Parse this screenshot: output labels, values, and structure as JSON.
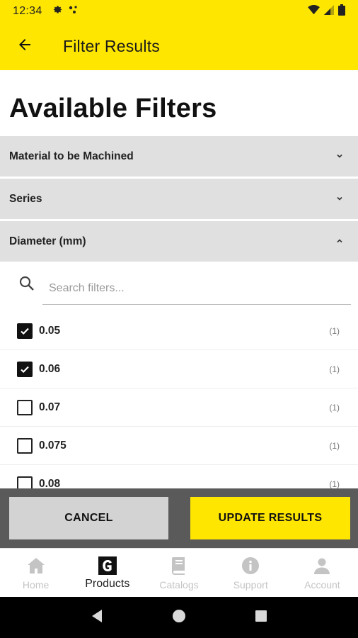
{
  "status_bar": {
    "time": "12:34",
    "left_icons": [
      "gear-icon",
      "notification-dots-icon"
    ],
    "right_icons": [
      "wifi-icon",
      "signal-icon",
      "battery-icon"
    ]
  },
  "app_bar": {
    "back_icon": "arrow-left-icon",
    "title": "Filter Results"
  },
  "page": {
    "heading": "Available Filters"
  },
  "sections": [
    {
      "label": "Material to be Machined",
      "expanded": false
    },
    {
      "label": "Series",
      "expanded": false
    },
    {
      "label": "Diameter (mm)",
      "expanded": true
    }
  ],
  "search": {
    "placeholder": "Search filters..."
  },
  "options": [
    {
      "label": "0.05",
      "count": "(1)",
      "checked": true
    },
    {
      "label": "0.06",
      "count": "(1)",
      "checked": true
    },
    {
      "label": "0.07",
      "count": "(1)",
      "checked": false
    },
    {
      "label": "0.075",
      "count": "(1)",
      "checked": false
    },
    {
      "label": "0.08",
      "count": "(1)",
      "checked": false
    }
  ],
  "actions": {
    "cancel_label": "CANCEL",
    "update_label": "UPDATE RESULTS"
  },
  "bottom_nav": [
    {
      "label": "Home",
      "icon": "home-icon",
      "active": false
    },
    {
      "label": "Products",
      "icon": "products-g-icon",
      "active": true
    },
    {
      "label": "Catalogs",
      "icon": "book-icon",
      "active": false
    },
    {
      "label": "Support",
      "icon": "info-icon",
      "active": false
    },
    {
      "label": "Account",
      "icon": "person-icon",
      "active": false
    }
  ],
  "colors": {
    "brand_yellow": "#ffe600",
    "section_gray": "#e0e0e0",
    "action_bar": "#5a5a5a",
    "cancel_button": "#d3d3d3",
    "nav_inactive": "#c4c4c4"
  }
}
